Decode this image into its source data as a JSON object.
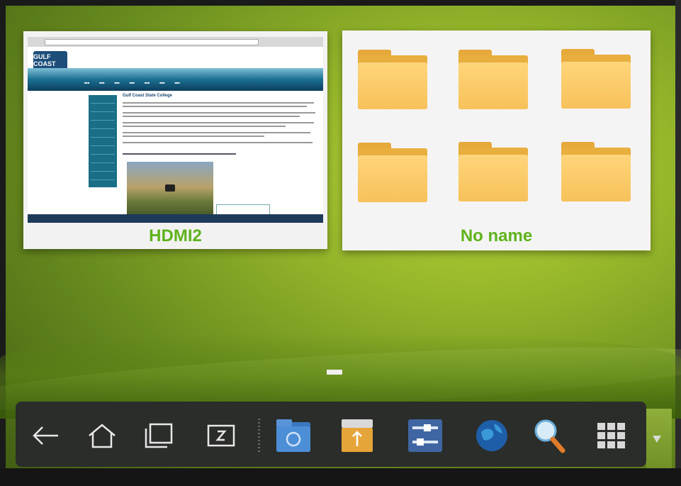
{
  "recent_apps": [
    {
      "label": "HDMI2",
      "thumbnail": "browser-window-gulf-coast-state-college"
    },
    {
      "label": "No name",
      "thumbnail": "file-manager-folder-grid"
    }
  ],
  "hdmi_screen": {
    "logo_text": "GULF COAST",
    "page_heading": "Gulf Coast State College"
  },
  "dock": {
    "items": [
      {
        "name": "back-icon"
      },
      {
        "name": "home-icon"
      },
      {
        "name": "recent-apps-icon"
      },
      {
        "name": "screenshot-icon"
      },
      {
        "name": "file-manager-icon"
      },
      {
        "name": "usb-storage-icon"
      },
      {
        "name": "settings-icon"
      },
      {
        "name": "browser-globe-icon"
      },
      {
        "name": "search-icon"
      },
      {
        "name": "app-grid-icon"
      }
    ],
    "expand_icon": "chevron-down-icon"
  },
  "colors": {
    "label_green": "#5fb31c",
    "folder": "#f7c15a",
    "dock": "#2b2d2a"
  }
}
